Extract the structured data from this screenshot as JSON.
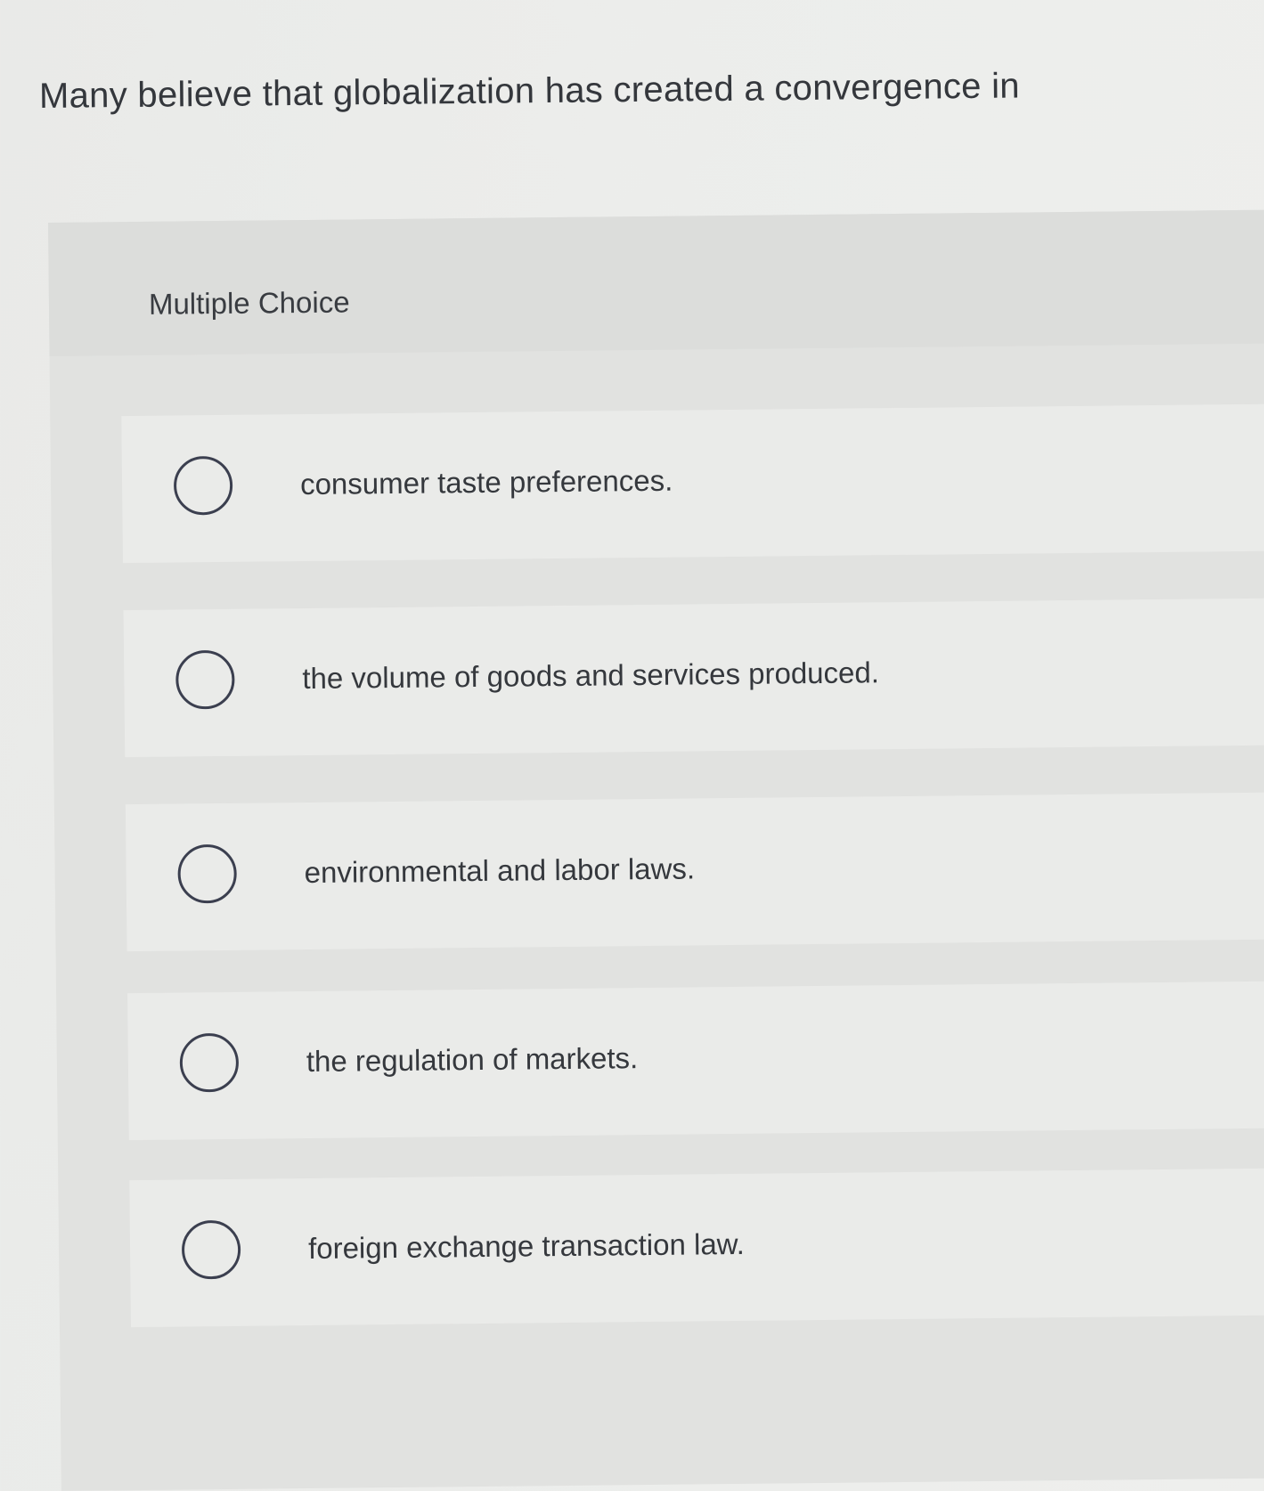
{
  "question": {
    "text": "Many believe that globalization has created a convergence in"
  },
  "section": {
    "label": "Multiple Choice"
  },
  "options": [
    {
      "label": "consumer taste preferences.",
      "selected": false
    },
    {
      "label": "the volume of goods and services produced.",
      "selected": false
    },
    {
      "label": "environmental and labor laws.",
      "selected": false
    },
    {
      "label": "the regulation of markets.",
      "selected": false
    },
    {
      "label": "foreign exchange transaction law.",
      "selected": false
    }
  ]
}
